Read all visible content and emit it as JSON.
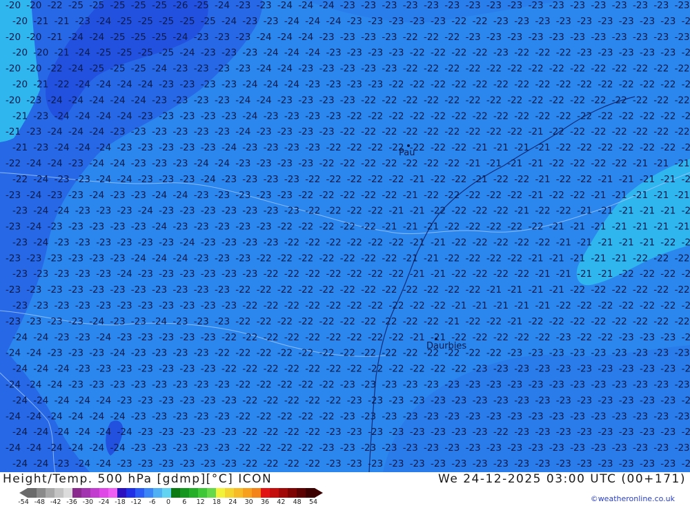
{
  "map": {
    "product": "ICON 500 hPa Height/Temperature",
    "grid": [
      "20 20 22 25 25 25 25 25 26 25 24 23 23 24 24 24 23 23 23 23 23 23 23 23 23 23 23 23 23 23 23 23 23",
      "20 21 21 23 24 25 25 25 25 25 24 23 23 24 24 24 23 23 23 23 23 22 22 23 23 23 23 23 23 23 23 23 23",
      "20 20 21 24 24 25 25 25 24 23 23 23 24 24 24 23 23 23 23 22 22 22 23 23 23 23 23 23 23 23 23 23 23",
      "20 20 21 24 25 25 25 25 24 23 23 23 24 24 24 23 23 23 23 22 22 22 22 23 22 22 22 23 23 23 23 23 23",
      "20 20 22 24 25 25 25 24 23 23 23 23 24 24 23 23 23 23 23 22 22 22 22 22 22 22 22 22 22 22 22 22 22",
      "20 21 22 24 24 24 24 23 23 23 23 24 24 24 23 23 23 23 22 22 22 22 22 22 22 22 22 22 22 22 22 22 22",
      "20 23 24 24 24 24 24 23 23 23 23 24 24 23 23 23 23 22 22 22 22 22 22 22 22 22 22 22 22 22 22 22 22",
      "21 23 24 24 24 24 23 23 23 23 23 24 23 23 23 23 22 22 22 22 22 22 22 22 22 22 22 22 22 22 22 22 22",
      "21 23 24 24 24 23 23 23 23 23 23 24 23 23 23 23 22 22 22 22 22 22 22 22 22 21 22 22 22 22 22 22 22",
      "21 23 24 24 24 23 23 23 23 23 24 23 23 23 23 22 22 22 22 22 22 22 21 21 21 21 22 22 22 22 22 22 22",
      "22 24 24 23 24 24 23 23 23 24 24 23 23 23 23 22 22 22 22 22 22 22 21 21 21 21 22 22 22 22 21 21 21",
      "22 24 23 23 24 24 23 23 23 24 23 23 23 23 22 22 22 22 22 21 22 22 21 22 22 21 22 22 21 21 21 21 21",
      "23 24 23 23 24 23 23 24 24 23 23 23 23 23 22 22 22 22 22 21 22 22 22 22 22 21 22 22 21 21 21 21 21",
      "23 24 24 23 23 23 24 23 23 23 23 23 23 23 22 22 22 22 21 21 22 22 22 22 21 22 22 21 21 21 21 21 21",
      "23 24 23 23 23 23 23 24 23 23 23 23 23 22 22 22 22 22 21 21 21 22 22 22 22 22 21 21 21 21 21 21 21",
      "23 24 23 23 23 23 23 23 24 23 23 23 23 22 22 22 22 22 22 21 21 22 22 22 22 22 21 21 21 21 21 22 22",
      "23 23 23 23 23 23 24 24 24 23 23 23 22 22 22 22 22 22 22 21 21 22 22 22 22 21 21 21 21 21 22 22 22",
      "23 23 23 23 23 24 23 23 23 23 23 23 22 22 22 22 22 22 22 21 21 22 22 22 22 21 21 21 21 22 22 22 22",
      "23 23 23 23 23 23 23 23 23 23 23 22 22 22 22 22 22 22 22 22 22 22 22 21 21 21 21 22 22 22 22 22 22",
      "23 23 23 23 23 23 23 23 23 23 23 22 22 22 22 22 22 22 22 22 22 21 21 21 21 21 22 22 22 22 22 22 22",
      "23 23 23 23 24 23 23 24 23 23 23 22 22 22 22 22 22 22 22 22 22 21 22 22 21 22 22 22 22 22 22 22 22",
      "24 24 23 23 24 23 23 23 23 23 22 22 22 22 22 22 22 22 22 21 21 22 22 22 22 22 23 22 22 23 23 23 23",
      "24 24 23 23 23 24 23 23 23 23 22 22 22 22 22 22 22 22 22 22 22 22 22 22 23 23 23 23 23 23 23 23 23",
      "24 24 24 23 23 23 23 23 23 23 22 22 22 22 22 22 22 22 22 22 22 22 23 23 23 23 23 23 23 23 23 23 23",
      "24 24 24 23 23 23 23 23 23 23 23 22 22 22 22 22 23 23 23 23 23 23 23 23 23 23 23 23 23 23 23 23 23",
      "24 24 24 24 24 23 23 23 23 23 23 22 22 22 22 22 23 23 23 23 23 23 23 23 23 23 23 23 23 23 23 23 23",
      "24 24 24 24 24 24 23 23 23 23 23 22 22 22 22 22 23 23 23 23 23 23 23 23 23 23 23 23 23 23 23 23 23",
      "24 24 24 24 24 24 23 23 23 23 23 22 22 22 22 23 23 23 23 23 23 23 23 22 23 23 23 23 23 23 23 23 23",
      "24 24 24 24 24 24 23 23 23 23 23 22 22 22 22 23 23 23 23 23 23 23 23 23 23 23 23 23 23 23 23 23 23",
      "24 24 23 24 24 23 23 23 23 23 23 22 22 22 22 23 23 23 23 23 23 23 23 23 23 23 23 23 23 23 23 23 23"
    ],
    "places": [
      {
        "name": "Pau",
        "kind": "city-dot"
      },
      {
        "name": "Daurbies",
        "kind": "city-dot"
      }
    ]
  },
  "footer": {
    "title_left": "Height/Temp. 500 hPa [gdmp][°C] ICON",
    "title_right": "We 24-12-2025 03:00 UTC (00+171)",
    "credit": "©weatheronline.co.uk"
  },
  "legend": {
    "ticks": [
      "-54",
      "-48",
      "-42",
      "-36",
      "-30",
      "-24",
      "-18",
      "-12",
      "-6",
      "0",
      "6",
      "12",
      "18",
      "24",
      "30",
      "36",
      "42",
      "48",
      "54"
    ],
    "colors": [
      "#6b6b6b",
      "#8a8a8a",
      "#a8a8a8",
      "#c4c4c4",
      "#dcdcdc",
      "#8a2a8f",
      "#a334b0",
      "#c23ccf",
      "#df48e6",
      "#f05ff4",
      "#2c0fbf",
      "#1e2fe6",
      "#2a5cf5",
      "#3b86f6",
      "#4fb0f4",
      "#62d3f0",
      "#0b7a12",
      "#14951d",
      "#24ae28",
      "#3fc737",
      "#66d94a",
      "#f3f23a",
      "#f4d52f",
      "#f6bb26",
      "#f6a01d",
      "#f48318",
      "#e21313",
      "#c40d0d",
      "#a10808",
      "#7e0404",
      "#5c0202",
      "#3d0000"
    ]
  }
}
